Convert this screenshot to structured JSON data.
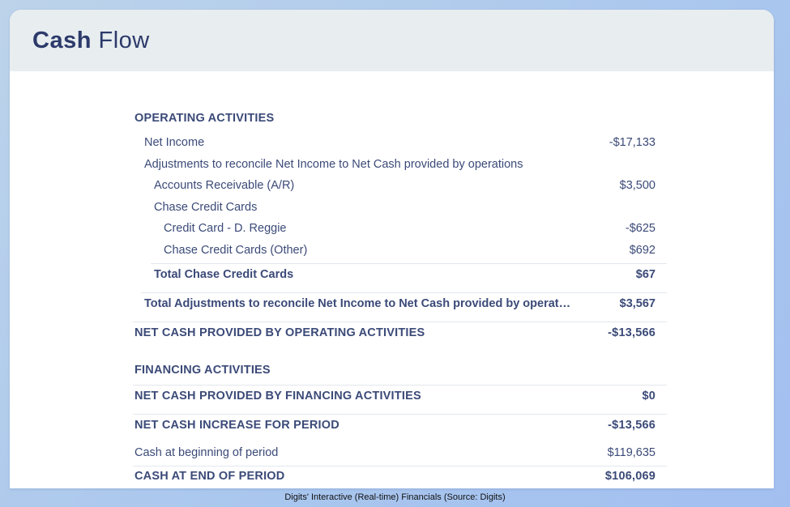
{
  "header": {
    "title_bold": "Cash",
    "title_light": "Flow"
  },
  "report": {
    "operating_heading": "OPERATING ACTIVITIES",
    "net_income": {
      "label": "Net Income",
      "value": "-$17,133"
    },
    "adjustments_heading": "Adjustments to reconcile Net Income to Net Cash provided by operations",
    "accounts_receivable": {
      "label": "Accounts Receivable (A/R)",
      "value": "$3,500"
    },
    "chase_heading": "Chase Credit Cards",
    "credit_card_reggie": {
      "label": "Credit Card - D. Reggie",
      "value": "-$625"
    },
    "chase_other": {
      "label": "Chase Credit Cards (Other)",
      "value": "$692"
    },
    "total_chase": {
      "label": "Total Chase Credit Cards",
      "value": "$67"
    },
    "total_adjustments": {
      "label": "Total Adjustments to reconcile Net Income to Net Cash provided by operat…",
      "value": "$3,567"
    },
    "net_cash_operating": {
      "label": "NET CASH PROVIDED BY OPERATING ACTIVITIES",
      "value": "-$13,566"
    },
    "financing_heading": "FINANCING ACTIVITIES",
    "net_cash_financing": {
      "label": "NET CASH PROVIDED BY FINANCING ACTIVITIES",
      "value": "$0"
    },
    "net_cash_increase": {
      "label": "NET CASH INCREASE FOR PERIOD",
      "value": "-$13,566"
    },
    "cash_beginning": {
      "label": "Cash at beginning of period",
      "value": "$119,635"
    },
    "cash_end": {
      "label": "CASH AT END OF PERIOD",
      "value": "$106,069"
    }
  },
  "caption": "Digits' Interactive (Real-time) Financials (Source: Digits)",
  "colors": {
    "text": "#3b4a78",
    "title": "#2c3a6b",
    "header_bg": "#e8edef"
  }
}
